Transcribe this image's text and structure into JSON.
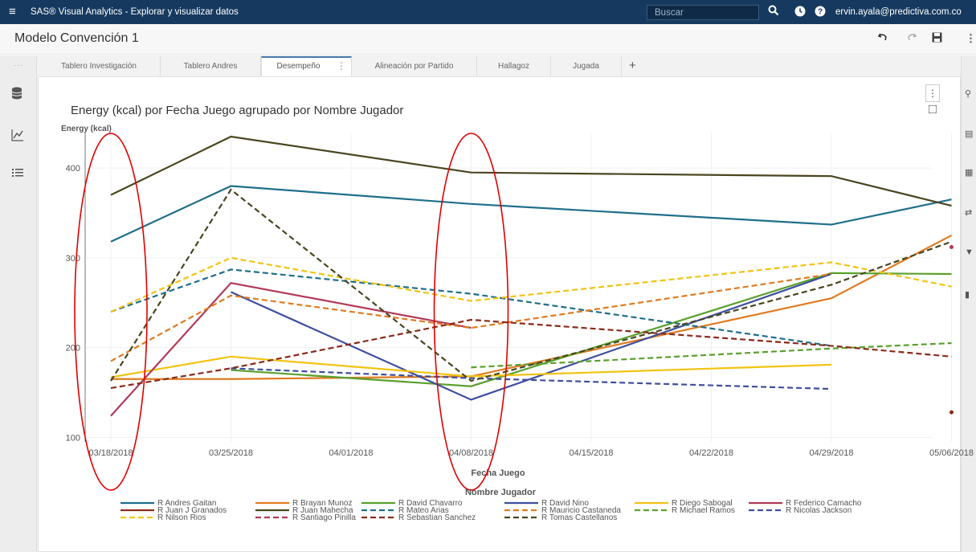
{
  "topbar": {
    "app_title": "SAS® Visual Analytics - Explorar y visualizar datos",
    "search_placeholder": "Buscar",
    "user": "ervin.ayala@predictiva.com.co"
  },
  "report": {
    "title": "Modelo Convención 1"
  },
  "tabs": [
    {
      "label": "Tablero Investigación",
      "active": false
    },
    {
      "label": "Tablero Andres",
      "active": false
    },
    {
      "label": "Desempeño",
      "active": true
    },
    {
      "label": "Alineación por Partido",
      "active": false
    },
    {
      "label": "Hallagoz",
      "active": false
    },
    {
      "label": "Jugada",
      "active": false
    }
  ],
  "icons": {
    "left_pane": [
      "database-icon",
      "line-chart-icon",
      "list-icon"
    ],
    "right_pane": [
      "roles-icon",
      "properties-icon",
      "styles-icon",
      "actions-icon",
      "filter-icon",
      "ranks-icon"
    ]
  },
  "chart_data": {
    "type": "line",
    "title": "Energy (kcal) por Fecha Juego agrupado por Nombre Jugador",
    "xlabel": "Fecha Juego",
    "ylabel": "Energy (kcal)",
    "legend_title": "Nombre Jugador",
    "legend_position": "bottom",
    "grid": true,
    "x_ticks": [
      "03/18/2018",
      "03/25/2018",
      "04/01/2018",
      "04/08/2018",
      "04/15/2018",
      "04/22/2018",
      "04/29/2018",
      "05/06/2018"
    ],
    "y_ticks": [
      100,
      200,
      300,
      400
    ],
    "ylim": [
      95,
      435
    ],
    "series": [
      {
        "name": "R Andres Gaitan",
        "color": "#1f6f8b",
        "dash": false,
        "points": [
          [
            "03/18/2018",
            318
          ],
          [
            "03/25/2018",
            380
          ],
          [
            "04/08/2018",
            360
          ],
          [
            "04/29/2018",
            337
          ],
          [
            "05/06/2018",
            365
          ]
        ]
      },
      {
        "name": "R Brayan Munoz",
        "color": "#e07b20",
        "dash": false,
        "points": [
          [
            "03/18/2018",
            165
          ],
          [
            "03/25/2018",
            165
          ],
          [
            "04/08/2018",
            168
          ],
          [
            "04/29/2018",
            255
          ],
          [
            "05/06/2018",
            325
          ]
        ]
      },
      {
        "name": "R David Chavarro",
        "color": "#5aa02c",
        "dash": false,
        "points": [
          [
            "03/25/2018",
            175
          ],
          [
            "04/08/2018",
            157
          ],
          [
            "04/29/2018",
            283
          ],
          [
            "05/06/2018",
            282
          ]
        ]
      },
      {
        "name": "R David Nino",
        "color": "#3e4f9e",
        "dash": false,
        "points": [
          [
            "03/25/2018",
            262
          ],
          [
            "04/08/2018",
            142
          ],
          [
            "04/29/2018",
            282
          ]
        ]
      },
      {
        "name": "R Diego Sabogal",
        "color": "#f2c311",
        "dash": false,
        "points": [
          [
            "03/18/2018",
            167
          ],
          [
            "03/25/2018",
            190
          ],
          [
            "04/08/2018",
            168
          ],
          [
            "04/29/2018",
            181
          ]
        ]
      },
      {
        "name": "R Federico Camacho",
        "color": "#b03a5a",
        "dash": false,
        "points": [
          [
            "03/18/2018",
            124
          ],
          [
            "03/25/2018",
            272
          ],
          [
            "04/08/2018",
            222
          ]
        ]
      },
      {
        "name": "R Juan J Granados",
        "color": "#8b2a1a",
        "dash": false,
        "points": [
          [
            "05/06/2018",
            128
          ]
        ]
      },
      {
        "name": "R Juan Mahecha",
        "color": "#4a4620",
        "dash": false,
        "points": [
          [
            "03/18/2018",
            370
          ],
          [
            "03/25/2018",
            435
          ],
          [
            "04/08/2018",
            395
          ],
          [
            "04/29/2018",
            391
          ],
          [
            "05/06/2018",
            358
          ]
        ]
      },
      {
        "name": "R Mateo Arias",
        "color": "#1f6f8b",
        "dash": true,
        "points": [
          [
            "03/18/2018",
            240
          ],
          [
            "03/25/2018",
            287
          ],
          [
            "04/08/2018",
            260
          ],
          [
            "04/29/2018",
            202
          ]
        ]
      },
      {
        "name": "R Mauricio Castaneda",
        "color": "#e07b20",
        "dash": true,
        "points": [
          [
            "03/18/2018",
            185
          ],
          [
            "03/25/2018",
            258
          ],
          [
            "04/08/2018",
            222
          ],
          [
            "04/29/2018",
            282
          ]
        ]
      },
      {
        "name": "R Michael Ramos",
        "color": "#5aa02c",
        "dash": true,
        "points": [
          [
            "04/08/2018",
            178
          ],
          [
            "04/29/2018",
            199
          ],
          [
            "05/06/2018",
            205
          ]
        ]
      },
      {
        "name": "R Nicolas Jackson",
        "color": "#3e4f9e",
        "dash": true,
        "points": [
          [
            "03/25/2018",
            177
          ],
          [
            "04/08/2018",
            166
          ],
          [
            "04/29/2018",
            154
          ]
        ]
      },
      {
        "name": "R Nilson Rios",
        "color": "#f2c311",
        "dash": true,
        "points": [
          [
            "03/18/2018",
            240
          ],
          [
            "03/25/2018",
            300
          ],
          [
            "04/08/2018",
            252
          ],
          [
            "04/29/2018",
            295
          ],
          [
            "05/06/2018",
            268
          ]
        ]
      },
      {
        "name": "R Santiago Pinilla",
        "color": "#b03a5a",
        "dash": true,
        "points": [
          [
            "05/06/2018",
            312
          ]
        ]
      },
      {
        "name": "R Sebastian Sanchez",
        "color": "#8b2a1a",
        "dash": true,
        "points": [
          [
            "03/18/2018",
            155
          ],
          [
            "03/25/2018",
            177
          ],
          [
            "04/08/2018",
            231
          ],
          [
            "04/29/2018",
            202
          ],
          [
            "05/06/2018",
            190
          ]
        ]
      },
      {
        "name": "R Tomas Castellanos",
        "color": "#4a4620",
        "dash": true,
        "points": [
          [
            "03/18/2018",
            163
          ],
          [
            "03/25/2018",
            376
          ],
          [
            "04/08/2018",
            163
          ],
          [
            "04/29/2018",
            270
          ],
          [
            "05/06/2018",
            318
          ]
        ]
      }
    ],
    "annotations": [
      {
        "type": "ellipse",
        "color": "#e00000",
        "around": "03/18/2018"
      },
      {
        "type": "ellipse",
        "color": "#e00000",
        "around": "04/08/2018"
      }
    ]
  }
}
